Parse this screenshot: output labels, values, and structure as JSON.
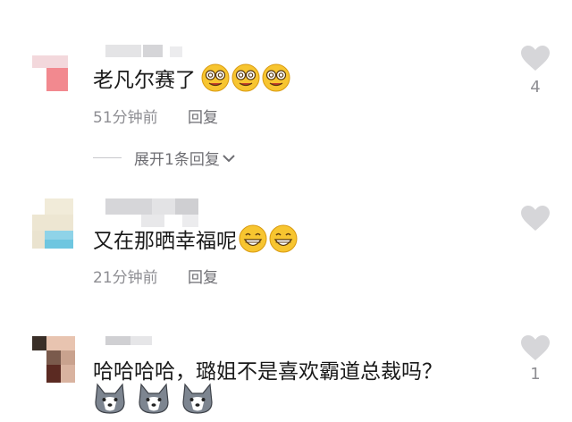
{
  "comments": [
    {
      "text": "老凡尔赛了",
      "emojis": [
        "dizzy-smile-emoji",
        "dizzy-smile-emoji",
        "dizzy-smile-emoji"
      ],
      "time": "51分钟前",
      "reply_label": "回复",
      "likes": "4",
      "expand_label": "展开1条回复"
    },
    {
      "text": "又在那晒幸福呢",
      "emojis": [
        "grin-emoji",
        "grin-emoji"
      ],
      "time": "21分钟前",
      "reply_label": "回复",
      "likes": ""
    },
    {
      "text": "哈哈哈哈，璐姐不是喜欢霸道总裁吗？",
      "emojis": [
        "husky-emoji",
        "husky-emoji",
        "husky-emoji"
      ],
      "likes": "1"
    }
  ],
  "colors": {
    "text": "#1a1a1a",
    "meta": "#8e8e93",
    "heart": "#d6d6d9",
    "emoji_yellow": "#f7c530"
  }
}
